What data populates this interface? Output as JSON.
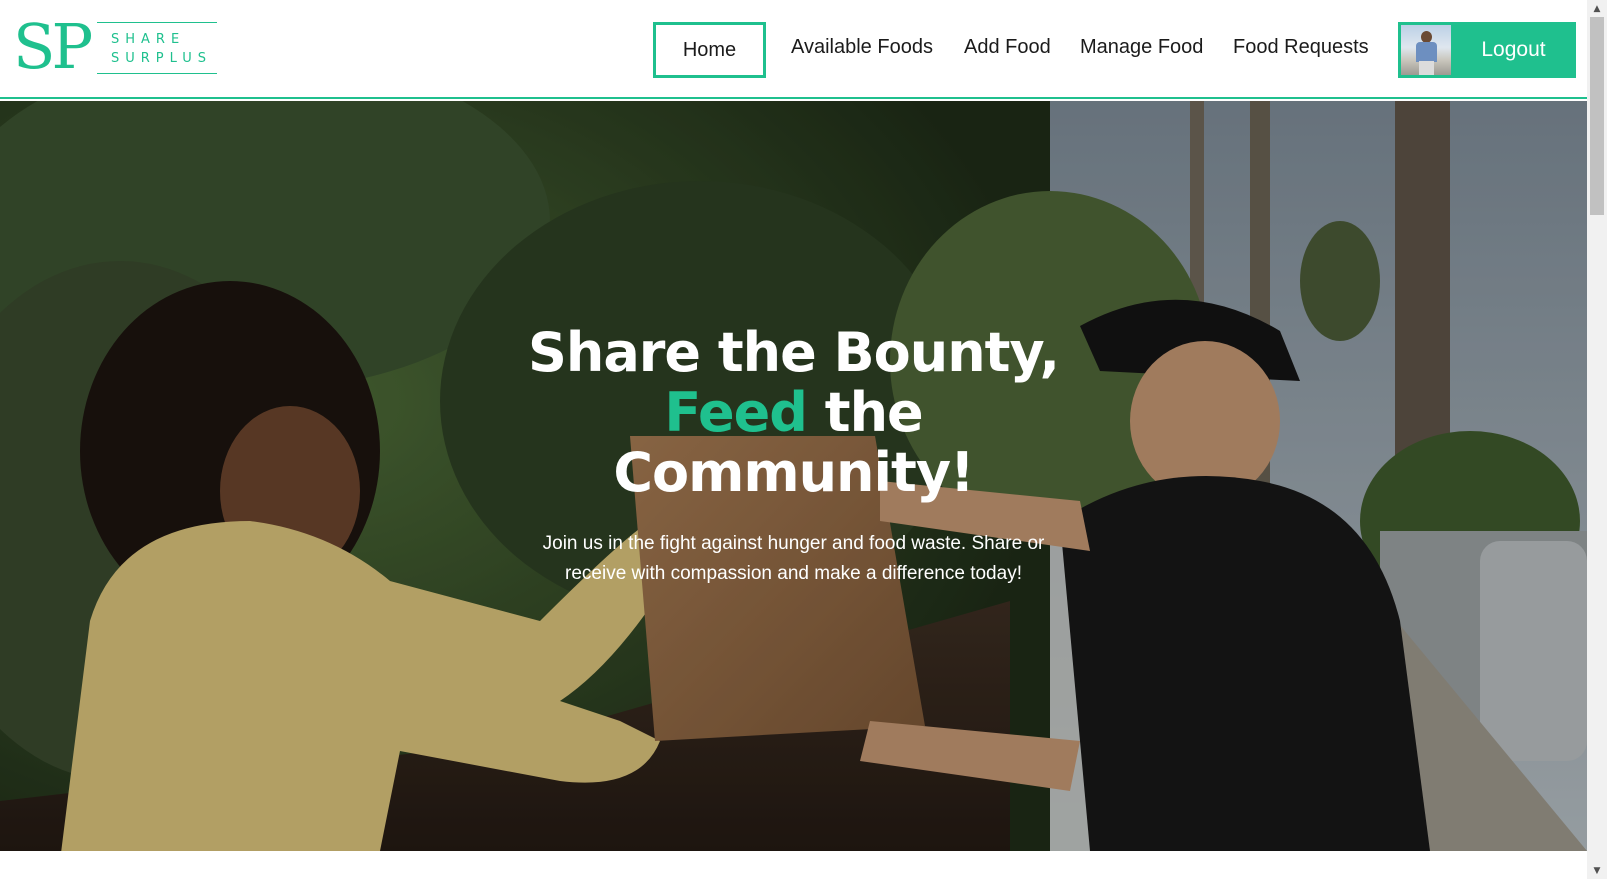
{
  "brand": {
    "monogram": "SP",
    "word1": "SHARE",
    "word2": "SURPLUS",
    "color": "#1fc08e"
  },
  "nav": {
    "home": "Home",
    "available_foods": "Available Foods",
    "add_food": "Add Food",
    "manage_food": "Manage Food",
    "food_requests": "Food Requests",
    "logout": "Logout"
  },
  "hero": {
    "title_line1": "Share the Bounty,",
    "title_accent": "Feed",
    "title_line2_rest": " the",
    "title_line3": "Community!",
    "subtitle": "Join us in the fight against hunger and food waste. Share or receive with compassion and make a difference today!"
  },
  "icons": {
    "avatar": "user-avatar",
    "scroll_up": "scroll-up-arrow",
    "scroll_down": "scroll-down-arrow"
  }
}
